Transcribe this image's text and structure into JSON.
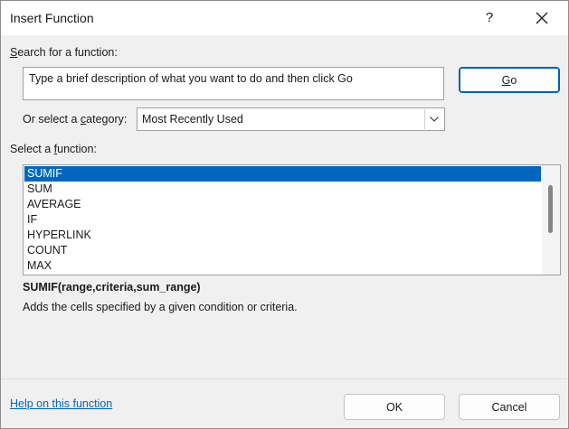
{
  "window": {
    "title": "Insert Function",
    "help_glyph": "?"
  },
  "search": {
    "label_prefix": "",
    "label_hotkey": "S",
    "label_rest": "earch for a function:",
    "value": "Type a brief description of what you want to do and then click Go",
    "go_hotkey": "G",
    "go_rest": "o"
  },
  "category": {
    "label_prefix": "Or select a ",
    "label_hotkey": "c",
    "label_rest": "ategory:",
    "selected": "Most Recently Used"
  },
  "functions": {
    "label_prefix": "Select a ",
    "label_hotkey": "f",
    "label_rest": "unction:",
    "items": [
      "SUMIF",
      "SUM",
      "AVERAGE",
      "IF",
      "HYPERLINK",
      "COUNT",
      "MAX"
    ],
    "selected_index": 0,
    "syntax": "SUMIF(range,criteria,sum_range)",
    "description": "Adds the cells specified by a given condition or criteria."
  },
  "footer": {
    "help_link": "Help on this function",
    "ok_label": "OK",
    "cancel_label": "Cancel"
  },
  "colors": {
    "accent": "#0067c0",
    "selection_bg": "#0067c0",
    "selection_text": "#ffffff",
    "dialog_bg": "#f0f0f0"
  },
  "icons": {
    "close": "close-icon",
    "dropdown": "chevron-down-icon"
  }
}
